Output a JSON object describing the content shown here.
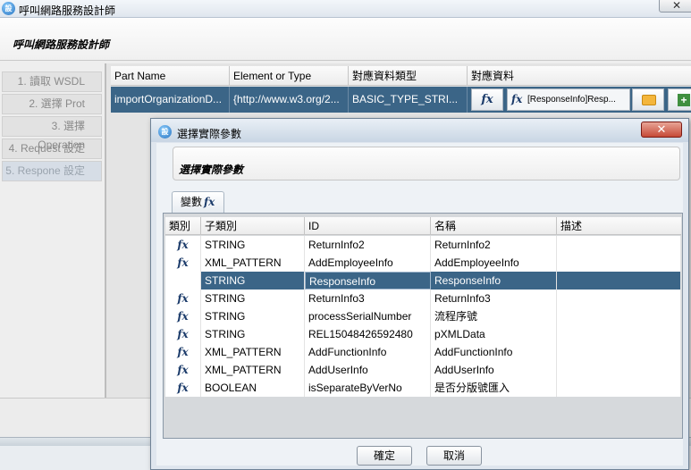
{
  "window": {
    "title": "呼叫網路服務設計師",
    "close_label": "✕",
    "icon_glyph": "設"
  },
  "header": {
    "title": "呼叫網路服務設計師"
  },
  "steps": [
    {
      "label": "1. 讀取 WSDL"
    },
    {
      "label": "2. 選擇 Prot"
    },
    {
      "label": "3. 選擇 Operation"
    },
    {
      "label": "4. Request 設定"
    },
    {
      "label": "5. Respone 設定"
    }
  ],
  "table": {
    "columns": [
      "Part Name",
      "Element or Type",
      "對應資料類型",
      "對應資料"
    ],
    "row": {
      "part_name": "importOrganizationD...",
      "element_or_type": "{http://www.w3.org/2...",
      "data_type": "BASIC_TYPE_STRI...",
      "fx_label": "fx",
      "mapping_fx": "fx",
      "mapping_value": "[ResponseInfo]Resp..."
    }
  },
  "dialog": {
    "title": "選擇實際參數",
    "close_label": "✕",
    "header_title": "選擇實際參數",
    "tab_label": "變數",
    "tab_fx": "fx",
    "columns": [
      "類別",
      "子類別",
      "ID",
      "名稱",
      "描述"
    ],
    "rows": [
      {
        "fx": "fx",
        "subtype": "STRING",
        "id": "ReturnInfo2",
        "name": "ReturnInfo2",
        "desc": ""
      },
      {
        "fx": "fx",
        "subtype": "XML_PATTERN",
        "id": "AddEmployeeInfo",
        "name": "AddEmployeeInfo",
        "desc": ""
      },
      {
        "fx": "fx",
        "subtype": "STRING",
        "id": "ResponseInfo",
        "name": "ResponseInfo",
        "desc": ""
      },
      {
        "fx": "fx",
        "subtype": "STRING",
        "id": "ReturnInfo3",
        "name": "ReturnInfo3",
        "desc": ""
      },
      {
        "fx": "fx",
        "subtype": "STRING",
        "id": "processSerialNumber",
        "name": "流程序號",
        "desc": ""
      },
      {
        "fx": "fx",
        "subtype": "STRING",
        "id": "REL15048426592480",
        "name": "pXMLData",
        "desc": ""
      },
      {
        "fx": "fx",
        "subtype": "XML_PATTERN",
        "id": "AddFunctionInfo",
        "name": "AddFunctionInfo",
        "desc": ""
      },
      {
        "fx": "fx",
        "subtype": "XML_PATTERN",
        "id": "AddUserInfo",
        "name": "AddUserInfo",
        "desc": ""
      },
      {
        "fx": "fx",
        "subtype": "BOOLEAN",
        "id": "isSeparateByVerNo",
        "name": "是否分版號匯入",
        "desc": ""
      }
    ],
    "ok_label": "確定",
    "cancel_label": "取消"
  }
}
